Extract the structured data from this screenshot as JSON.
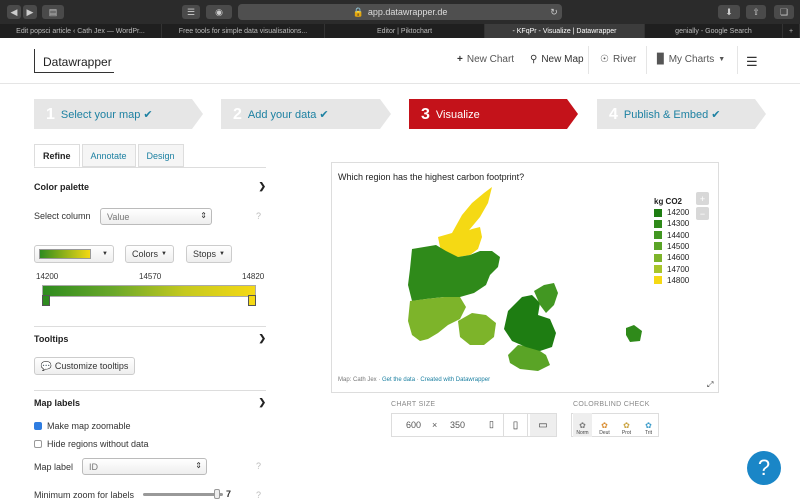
{
  "browser": {
    "url": "app.datawrapper.de",
    "tabs": [
      "Edit popsci article ‹ Cath Jex — WordPr...",
      "Free tools for simple data visualisations...",
      "Editor | Piktochart",
      "- KFqPr - Visualize | Datawrapper",
      "genially - Google Search"
    ],
    "new_tab": "+"
  },
  "app": {
    "logo": "Datawrapper",
    "nav": {
      "new_chart": "New Chart",
      "new_map": "New Map",
      "river": "River",
      "my_charts": "My Charts"
    }
  },
  "steps": [
    {
      "num": "1",
      "label": "Select your map"
    },
    {
      "num": "2",
      "label": "Add your data"
    },
    {
      "num": "3",
      "label": "Visualize"
    },
    {
      "num": "4",
      "label": "Publish & Embed"
    }
  ],
  "panel_tabs": [
    "Refine",
    "Annotate",
    "Design"
  ],
  "color_palette": {
    "title": "Color palette",
    "select_column_label": "Select column",
    "select_column_value": "Value",
    "colors_btn": "Colors",
    "stops_btn": "Stops",
    "min": "14200",
    "mid": "14570",
    "max": "14820",
    "gradient_start": "#2e8b1f",
    "gradient_end": "#f5d914"
  },
  "tooltips": {
    "title": "Tooltips",
    "button": "Customize tooltips"
  },
  "map_labels": {
    "title": "Map labels",
    "zoomable": "Make map zoomable",
    "hide_regions": "Hide regions without data",
    "map_label_label": "Map label",
    "map_label_value": "ID",
    "min_zoom_label": "Minimum zoom for labels",
    "min_zoom_value": "7",
    "min_zoom_fraction": 0.92
  },
  "help_icon": "?",
  "chart": {
    "title": "Which region has the highest carbon footprint?",
    "legend_title": "kg CO2",
    "legend": [
      {
        "label": "14200",
        "color": "#1e7d12"
      },
      {
        "label": "14300",
        "color": "#2f8a1a"
      },
      {
        "label": "14400",
        "color": "#429722"
      },
      {
        "label": "14500",
        "color": "#5aa426"
      },
      {
        "label": "14600",
        "color": "#7db42a"
      },
      {
        "label": "14700",
        "color": "#a8c52a"
      },
      {
        "label": "14800",
        "color": "#f5d914"
      }
    ],
    "footer_prefix": "Map: Cath Jex · ",
    "footer_get_data": "Get the data",
    "footer_sep": " · ",
    "footer_created": "Created with Datawrapper",
    "zoom_in": "+",
    "zoom_out": "−"
  },
  "chart_size": {
    "label": "CHART SIZE",
    "width": "600",
    "x": "×",
    "height": "350"
  },
  "colorblind": {
    "label": "COLORBLIND CHECK",
    "options": [
      "Norm",
      "Deut",
      "Prot",
      "Trit"
    ]
  }
}
